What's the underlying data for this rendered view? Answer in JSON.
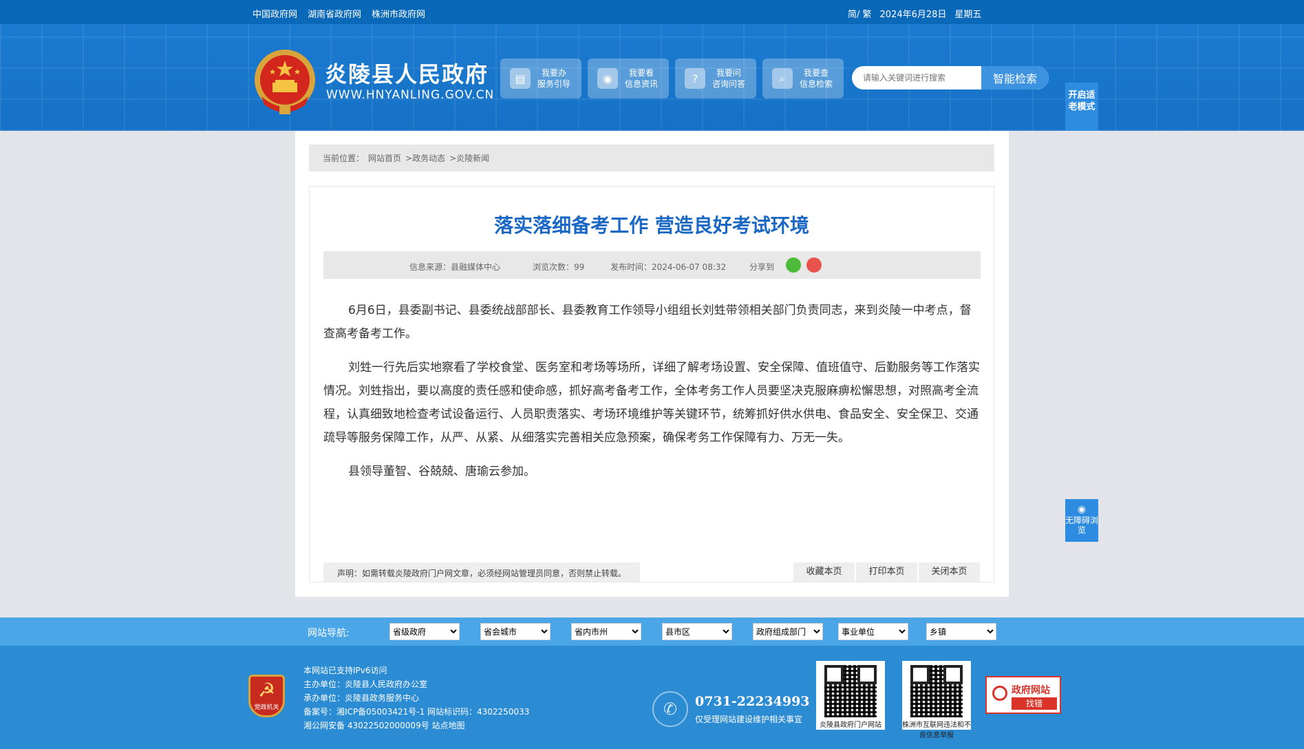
{
  "topbar": {
    "links": [
      "中国政府网",
      "湖南省政府网",
      "株洲市政府网"
    ],
    "lang": "简/ 繁",
    "date": "2024年6月28日",
    "weekday": "星期五"
  },
  "header": {
    "title": "炎陵县人民政府",
    "url": "WWW.HNYANLING.GOV.CN",
    "services": [
      {
        "line1": "我要办",
        "line2": "服务引导",
        "icon": "document-icon"
      },
      {
        "line1": "我要看",
        "line2": "信息资讯",
        "icon": "eye-icon"
      },
      {
        "line1": "我要问",
        "line2": "咨询问答",
        "icon": "question-icon"
      },
      {
        "line1": "我要查",
        "line2": "信息检索",
        "icon": "search-icon"
      }
    ],
    "search_placeholder": "请输入关键词进行搜索",
    "search_button": "智能检索",
    "elder_mode": "开启适老模式"
  },
  "breadcrumb": {
    "label": "当前位置：",
    "items": [
      "网站首页",
      ">政务动态",
      ">炎陵新闻"
    ]
  },
  "article": {
    "title": "落实落细备考工作 营造良好考试环境",
    "source": "信息来源：县融媒体中心",
    "views": "浏览次数：99",
    "published": "发布时间：2024-06-07 08:32",
    "share": "分享到",
    "paragraphs": [
      "6月6日，县委副书记、县委统战部部长、县委教育工作领导小组组长刘甡带领相关部门负责同志，来到炎陵一中考点，督查高考备考工作。",
      "刘甡一行先后实地察看了学校食堂、医务室和考场等场所，详细了解考场设置、安全保障、值班值守、后勤服务等工作落实情况。刘甡指出，要以高度的责任感和使命感，抓好高考备考工作，全体考务工作人员要坚决克服麻痹松懈思想，对照高考全流程，认真细致地检查考试设备运行、人员职责落实、考场环境维护等关键环节，统筹抓好供水供电、食品安全、安全保卫、交通疏导等服务保障工作，从严、从紧、从细落实完善相关应急预案，确保考务工作保障有力、万无一失。",
      "县领导董智、谷兢兢、唐瑜云参加。"
    ],
    "notice": "声明：如需转载炎陵政府门户网文章，必须经网站管理员同意，否则禁止转载。",
    "tools": [
      "收藏本页",
      "打印本页",
      "关闭本页"
    ]
  },
  "accessibility": "无障碍浏览",
  "site_nav": {
    "label": "网站导航:",
    "selects": [
      "省级政府",
      "省会城市",
      "省内市州",
      "县市区",
      "政府组成部门",
      "事业单位",
      "乡镇"
    ]
  },
  "footer": {
    "badge": "党政机关",
    "lines": [
      "本网站已支持IPv6访问",
      "主办单位：炎陵县人民政府办公室",
      "承办单位：炎陵县政务服务中心",
      "备案号：湘ICP备05003421号-1 网站标识码：4302250033",
      "湘公网安备 43022502000009号 站点地图"
    ],
    "phone": "0731-22234993",
    "phone_note": "仅受理网站建设维护相关事宜",
    "qr1_caption": "炎陵县政府门户网站",
    "qr2_caption": "株洲市互联网违法和不良信息举报",
    "zfwz_line1": "政府网站",
    "zfwz_line2": "找错"
  }
}
